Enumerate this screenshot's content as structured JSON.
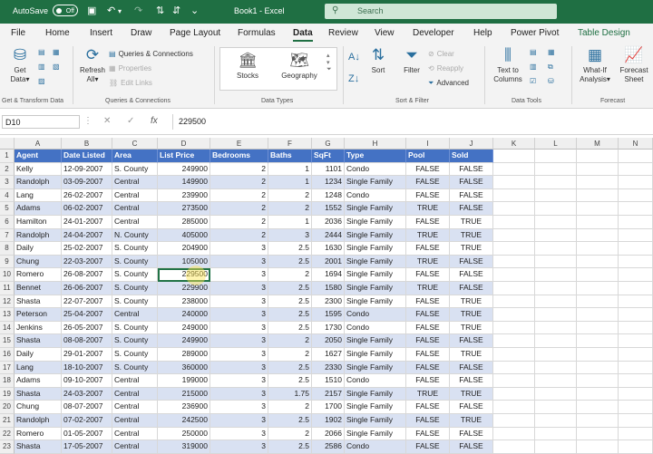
{
  "titlebar": {
    "autosave_label": "AutoSave",
    "autosave_state": "Off",
    "document_title": "Book1 - Excel",
    "search_placeholder": "Search"
  },
  "menu": [
    "File",
    "Home",
    "Insert",
    "Draw",
    "Page Layout",
    "Formulas",
    "Data",
    "Review",
    "View",
    "Developer",
    "Help",
    "Power Pivot",
    "Table Design"
  ],
  "menu_active": "Data",
  "ribbon": {
    "get_data": [
      "Get",
      "Data"
    ],
    "refresh": [
      "Refresh",
      "All"
    ],
    "queries_connections": "Queries & Connections",
    "properties": "Properties",
    "edit_links": "Edit Links",
    "stocks": "Stocks",
    "geography": "Geography",
    "sort": "Sort",
    "filter": "Filter",
    "clear": "Clear",
    "reapply": "Reapply",
    "advanced": "Advanced",
    "text_to_columns": [
      "Text to",
      "Columns"
    ],
    "what_if": [
      "What-If",
      "Analysis"
    ],
    "forecast_sheet": [
      "Forecast",
      "Sheet"
    ],
    "groups": {
      "get_transform": "Get & Transform Data",
      "queries": "Queries & Connections",
      "data_types": "Data Types",
      "sort_filter": "Sort & Filter",
      "data_tools": "Data Tools",
      "forecast": "Forecast"
    }
  },
  "formula_bar": {
    "name_box": "D10",
    "fx": "fx",
    "formula": "229500"
  },
  "sheet": {
    "columns": [
      "A",
      "B",
      "C",
      "D",
      "E",
      "F",
      "G",
      "H",
      "I",
      "J",
      "K",
      "L",
      "M",
      "N"
    ],
    "selected_cell": "D10",
    "headers": [
      "Agent",
      "Date Listed",
      "Area",
      "List Price",
      "Bedrooms",
      "Baths",
      "SqFt",
      "Type",
      "Pool",
      "Sold"
    ],
    "rows": [
      [
        "Kelly",
        "12-09-2007",
        "S. County",
        "249900",
        "2",
        "1",
        "1101",
        "Condo",
        "FALSE",
        "FALSE"
      ],
      [
        "Randolph",
        "03-09-2007",
        "Central",
        "149900",
        "2",
        "1",
        "1234",
        "Single Family",
        "FALSE",
        "FALSE"
      ],
      [
        "Lang",
        "26-02-2007",
        "Central",
        "239900",
        "2",
        "2",
        "1248",
        "Condo",
        "FALSE",
        "FALSE"
      ],
      [
        "Adams",
        "06-02-2007",
        "Central",
        "273500",
        "2",
        "2",
        "1552",
        "Single Family",
        "TRUE",
        "FALSE"
      ],
      [
        "Hamilton",
        "24-01-2007",
        "Central",
        "285000",
        "2",
        "1",
        "2036",
        "Single Family",
        "FALSE",
        "TRUE"
      ],
      [
        "Randolph",
        "24-04-2007",
        "N. County",
        "405000",
        "2",
        "3",
        "2444",
        "Single Family",
        "TRUE",
        "TRUE"
      ],
      [
        "Daily",
        "25-02-2007",
        "S. County",
        "204900",
        "3",
        "2.5",
        "1630",
        "Single Family",
        "FALSE",
        "TRUE"
      ],
      [
        "Chung",
        "22-03-2007",
        "S. County",
        "105000",
        "3",
        "2.5",
        "2001",
        "Single Family",
        "TRUE",
        "FALSE"
      ],
      [
        "Romero",
        "26-08-2007",
        "S. County",
        "229500",
        "3",
        "2",
        "1694",
        "Single Family",
        "FALSE",
        "FALSE"
      ],
      [
        "Bennet",
        "26-06-2007",
        "S. County",
        "229900",
        "3",
        "2.5",
        "1580",
        "Single Family",
        "TRUE",
        "FALSE"
      ],
      [
        "Shasta",
        "22-07-2007",
        "S. County",
        "238000",
        "3",
        "2.5",
        "2300",
        "Single Family",
        "FALSE",
        "TRUE"
      ],
      [
        "Peterson",
        "25-04-2007",
        "Central",
        "240000",
        "3",
        "2.5",
        "1595",
        "Condo",
        "FALSE",
        "TRUE"
      ],
      [
        "Jenkins",
        "26-05-2007",
        "S. County",
        "249000",
        "3",
        "2.5",
        "1730",
        "Condo",
        "FALSE",
        "TRUE"
      ],
      [
        "Shasta",
        "08-08-2007",
        "S. County",
        "249900",
        "3",
        "2",
        "2050",
        "Single Family",
        "FALSE",
        "FALSE"
      ],
      [
        "Daily",
        "29-01-2007",
        "S. County",
        "289000",
        "3",
        "2",
        "1627",
        "Single Family",
        "FALSE",
        "TRUE"
      ],
      [
        "Lang",
        "18-10-2007",
        "S. County",
        "360000",
        "3",
        "2.5",
        "2330",
        "Single Family",
        "FALSE",
        "FALSE"
      ],
      [
        "Adams",
        "09-10-2007",
        "Central",
        "199000",
        "3",
        "2.5",
        "1510",
        "Condo",
        "FALSE",
        "FALSE"
      ],
      [
        "Shasta",
        "24-03-2007",
        "Central",
        "215000",
        "3",
        "1.75",
        "2157",
        "Single Family",
        "TRUE",
        "TRUE"
      ],
      [
        "Chung",
        "08-07-2007",
        "Central",
        "236900",
        "3",
        "2",
        "1700",
        "Single Family",
        "FALSE",
        "FALSE"
      ],
      [
        "Randolph",
        "07-02-2007",
        "Central",
        "242500",
        "3",
        "2.5",
        "1902",
        "Single Family",
        "FALSE",
        "TRUE"
      ],
      [
        "Romero",
        "01-05-2007",
        "Central",
        "250000",
        "3",
        "2",
        "2066",
        "Single Family",
        "FALSE",
        "FALSE"
      ],
      [
        "Shasta",
        "17-05-2007",
        "Central",
        "319000",
        "3",
        "2.5",
        "2586",
        "Condo",
        "FALSE",
        "FALSE"
      ]
    ]
  },
  "colors": {
    "brand": "#1f6f43",
    "table_header": "#4472c4",
    "table_band": "#d9e1f2"
  }
}
